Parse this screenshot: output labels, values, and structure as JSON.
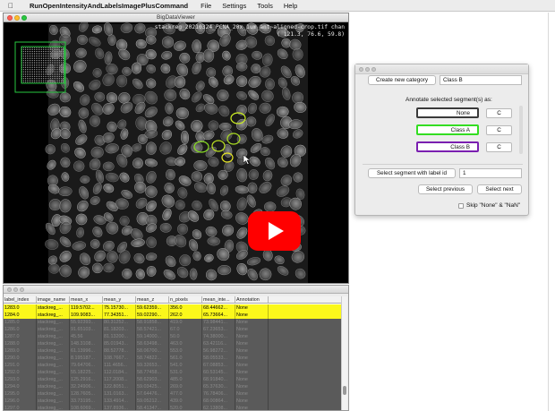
{
  "menubar": {
    "apple": "",
    "app_name": "RunOpenIntensityAndLabelsImagePlusCommand",
    "items": [
      "File",
      "Settings",
      "Tools",
      "Help"
    ]
  },
  "viewer": {
    "title": "BigDataViewer",
    "image_name": "stackreg_20210324_PCNA_20x_1um_ant~aligned-crop.tif chan",
    "coordinates": "( 121.3, 76.6, 59.8)"
  },
  "annotator": {
    "create_category_label": "Create new category",
    "new_category_value": "Class B",
    "annotate_heading": "Annotate selected segment(s) as:",
    "classes": [
      {
        "name": "None",
        "color": "#3a3a3a",
        "c_label": "C"
      },
      {
        "name": "Class A",
        "color": "#33dd22",
        "c_label": "C"
      },
      {
        "name": "Class B",
        "color": "#7a1fb0",
        "c_label": "C"
      }
    ],
    "select_segment_label": "Select segment with label id",
    "label_id_value": "1",
    "select_previous_label": "Select previous",
    "select_next_label": "Select next",
    "skip_label": "Skip \"None\" & \"NaN\""
  },
  "table": {
    "columns": [
      "label_index",
      "image_name",
      "mean_x",
      "mean_y",
      "mean_z",
      "n_pixels",
      "mean_inte...",
      "Annotation"
    ],
    "rows": [
      {
        "cells": [
          "1283.0",
          "stackreg_...",
          "119.5702...",
          "75.15730...",
          "59.62359...",
          "356.0",
          "68.44662...",
          "None"
        ],
        "state": "selected"
      },
      {
        "cells": [
          "1284.0",
          "stackreg_...",
          "109.9083...",
          "77.34351...",
          "59.02290...",
          "262.0",
          "65.73664...",
          "None"
        ],
        "state": "selected"
      },
      {
        "cells": [
          "1285.0",
          "stackreg_...",
          "55.92393...",
          "80.31252...",
          "58.91858...",
          "419.0",
          "73.98441...",
          "None"
        ],
        "state": "dimmed"
      },
      {
        "cells": [
          "1286.0",
          "stackreg_...",
          "91.65103...",
          "81.18203...",
          "58.57421...",
          "67.0",
          "67.23653...",
          "None"
        ],
        "state": "dimmed"
      },
      {
        "cells": [
          "1287.0",
          "stackreg_...",
          "45.56",
          "81.13200...",
          "59.14000...",
          "50.0",
          "74.38000...",
          "None"
        ],
        "state": "dimmed"
      },
      {
        "cells": [
          "1288.0",
          "stackreg_...",
          "148.3108...",
          "85.01943...",
          "58.63498...",
          "463.0",
          "63.42116...",
          "None"
        ],
        "state": "dimmed"
      },
      {
        "cells": [
          "1289.0",
          "stackreg_...",
          "61.13996...",
          "88.52778...",
          "58.06700...",
          "553.0",
          "56.98272...",
          "None"
        ],
        "state": "dimmed"
      },
      {
        "cells": [
          "1290.0",
          "stackreg_...",
          "8.195187...",
          "108.7667...",
          "58.74822...",
          "561.0",
          "58.05533...",
          "None"
        ],
        "state": "dimmed"
      },
      {
        "cells": [
          "1291.0",
          "stackreg_...",
          "79.64706...",
          "111.4656...",
          "59.32653...",
          "541.0",
          "67.08853...",
          "None"
        ],
        "state": "dimmed"
      },
      {
        "cells": [
          "1292.0",
          "stackreg_...",
          "55.18225...",
          "112.0184...",
          "58.77458...",
          "531.0",
          "60.53145...",
          "None"
        ],
        "state": "dimmed"
      },
      {
        "cells": [
          "1293.0",
          "stackreg_...",
          "125.2916...",
          "117.2008...",
          "58.62903...",
          "485.0",
          "68.91840...",
          "None"
        ],
        "state": "dimmed"
      },
      {
        "cells": [
          "1294.0",
          "stackreg_...",
          "32.24906...",
          "122.8051...",
          "59.03425...",
          "269.0",
          "65.37630...",
          "None"
        ],
        "state": "dimmed"
      },
      {
        "cells": [
          "1295.0",
          "stackreg_...",
          "128.7605...",
          "131.0163...",
          "57.64476...",
          "477.0",
          "76.78406...",
          "None"
        ],
        "state": "dimmed"
      },
      {
        "cells": [
          "1296.0",
          "stackreg_...",
          "33.73195...",
          "133.4914...",
          "59.05212...",
          "439.0",
          "68.00864...",
          "None"
        ],
        "state": "dimmed"
      },
      {
        "cells": [
          "1297.0",
          "stackreg_...",
          "108.6069...",
          "137.8936...",
          "58.41347...",
          "520.0",
          "62.13808...",
          "None"
        ],
        "state": "dimmed"
      }
    ]
  }
}
